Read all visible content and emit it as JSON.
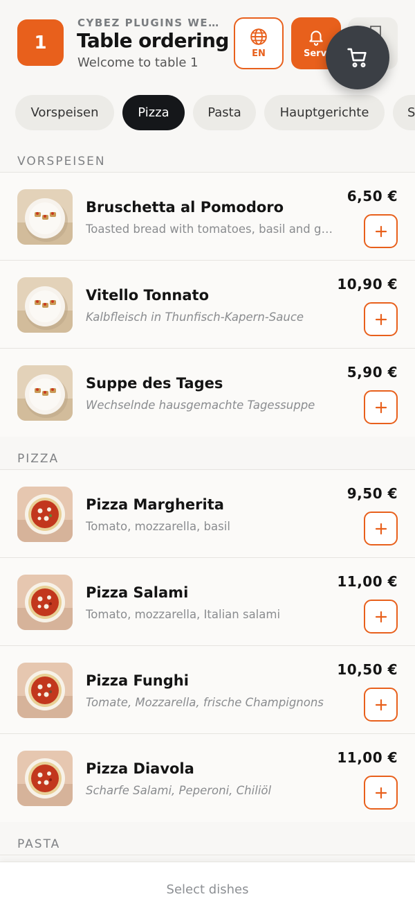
{
  "header": {
    "table_number": "1",
    "brand": "CYBEZ PLUGINS WEB…",
    "title": "Table ordering",
    "subtitle": "Welcome to table 1",
    "language_label": "EN",
    "service_label": "Service",
    "accent_color": "#e8601c"
  },
  "tabs": [
    {
      "label": "Vorspeisen",
      "active": false
    },
    {
      "label": "Pizza",
      "active": true
    },
    {
      "label": "Pasta",
      "active": false
    },
    {
      "label": "Hauptgerichte",
      "active": false
    },
    {
      "label": "S",
      "active": false
    }
  ],
  "sections": {
    "vorspeisen": {
      "title": "VORSPEISEN",
      "items": [
        {
          "name": "Bruschetta al Pomodoro",
          "description": "Toasted bread with tomatoes, basil and ga...",
          "price": "6,50 €"
        },
        {
          "name": "Vitello Tonnato",
          "description": "Kalbfleisch in Thunfisch-Kapern-Sauce",
          "price": "10,90 €"
        },
        {
          "name": "Suppe des Tages",
          "description": "Wechselnde hausgemachte Tagessuppe",
          "price": "5,90 €"
        }
      ]
    },
    "pizza": {
      "title": "PIZZA",
      "items": [
        {
          "name": "Pizza Margherita",
          "description": "Tomato, mozzarella, basil",
          "price": "9,50 €"
        },
        {
          "name": "Pizza Salami",
          "description": "Tomato, mozzarella, Italian salami",
          "price": "11,00 €"
        },
        {
          "name": "Pizza Funghi",
          "description": "Tomate, Mozzarella, frische Champignons",
          "price": "10,50 €"
        },
        {
          "name": "Pizza Diavola",
          "description": "Scharfe Salami, Peperoni, Chiliöl",
          "price": "11,00 €"
        }
      ]
    },
    "pasta": {
      "title": "PASTA"
    }
  },
  "add_button_label": "+",
  "bottom_bar": {
    "label": "Select dishes"
  }
}
